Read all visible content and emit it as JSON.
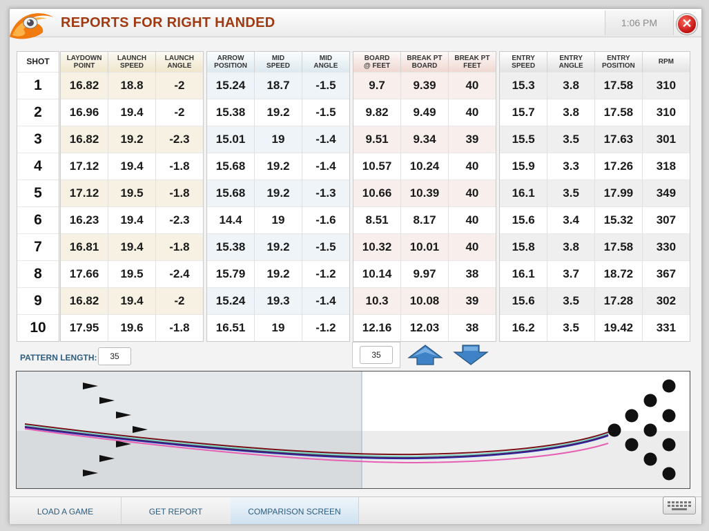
{
  "header": {
    "title": "REPORTS FOR RIGHT HANDED",
    "time": "1:06 PM",
    "close_label": "✕"
  },
  "groups": [
    {
      "columns": [
        "SHOT"
      ],
      "rows": [
        [
          "1"
        ],
        [
          "2"
        ],
        [
          "3"
        ],
        [
          "4"
        ],
        [
          "5"
        ],
        [
          "6"
        ],
        [
          "7"
        ],
        [
          "8"
        ],
        [
          "9"
        ],
        [
          "10"
        ]
      ]
    },
    {
      "columns": [
        [
          "LAYDOWN",
          "POINT"
        ],
        [
          "LAUNCH",
          "SPEED"
        ],
        [
          "LAUNCH",
          "ANGLE"
        ]
      ],
      "rows": [
        [
          "16.82",
          "18.8",
          "-2"
        ],
        [
          "16.96",
          "19.4",
          "-2"
        ],
        [
          "16.82",
          "19.2",
          "-2.3"
        ],
        [
          "17.12",
          "19.4",
          "-1.8"
        ],
        [
          "17.12",
          "19.5",
          "-1.8"
        ],
        [
          "16.23",
          "19.4",
          "-2.3"
        ],
        [
          "16.81",
          "19.4",
          "-1.8"
        ],
        [
          "17.66",
          "19.5",
          "-2.4"
        ],
        [
          "16.82",
          "19.4",
          "-2"
        ],
        [
          "17.95",
          "19.6",
          "-1.8"
        ]
      ]
    },
    {
      "columns": [
        [
          "ARROW",
          "POSITION"
        ],
        [
          "MID",
          "SPEED"
        ],
        [
          "MID",
          "ANGLE"
        ]
      ],
      "rows": [
        [
          "15.24",
          "18.7",
          "-1.5"
        ],
        [
          "15.38",
          "19.2",
          "-1.5"
        ],
        [
          "15.01",
          "19",
          "-1.4"
        ],
        [
          "15.68",
          "19.2",
          "-1.4"
        ],
        [
          "15.68",
          "19.2",
          "-1.3"
        ],
        [
          "14.4",
          "19",
          "-1.6"
        ],
        [
          "15.38",
          "19.2",
          "-1.5"
        ],
        [
          "15.79",
          "19.2",
          "-1.2"
        ],
        [
          "15.24",
          "19.3",
          "-1.4"
        ],
        [
          "16.51",
          "19",
          "-1.2"
        ]
      ]
    },
    {
      "columns": [
        [
          "BOARD",
          "@ FEET"
        ],
        [
          "BREAK PT",
          "BOARD"
        ],
        [
          "BREAK PT",
          "FEET"
        ]
      ],
      "rows": [
        [
          "9.7",
          "9.39",
          "40"
        ],
        [
          "9.82",
          "9.49",
          "40"
        ],
        [
          "9.51",
          "9.34",
          "39"
        ],
        [
          "10.57",
          "10.24",
          "40"
        ],
        [
          "10.66",
          "10.39",
          "40"
        ],
        [
          "8.51",
          "8.17",
          "40"
        ],
        [
          "10.32",
          "10.01",
          "40"
        ],
        [
          "10.14",
          "9.97",
          "38"
        ],
        [
          "10.3",
          "10.08",
          "39"
        ],
        [
          "12.16",
          "12.03",
          "38"
        ]
      ]
    },
    {
      "columns": [
        [
          "ENTRY",
          "SPEED"
        ],
        [
          "ENTRY",
          "ANGLE"
        ],
        [
          "ENTRY",
          "POSITION"
        ],
        [
          "RPM"
        ]
      ],
      "rows": [
        [
          "15.3",
          "3.8",
          "17.58",
          "310"
        ],
        [
          "15.7",
          "3.8",
          "17.58",
          "310"
        ],
        [
          "15.5",
          "3.5",
          "17.63",
          "301"
        ],
        [
          "15.9",
          "3.3",
          "17.26",
          "318"
        ],
        [
          "16.1",
          "3.5",
          "17.99",
          "349"
        ],
        [
          "15.6",
          "3.4",
          "15.32",
          "307"
        ],
        [
          "15.8",
          "3.8",
          "17.58",
          "330"
        ],
        [
          "16.1",
          "3.7",
          "18.72",
          "367"
        ],
        [
          "15.6",
          "3.5",
          "17.28",
          "302"
        ],
        [
          "16.2",
          "3.5",
          "19.42",
          "331"
        ]
      ]
    }
  ],
  "pattern": {
    "label": "PATTERN LENGTH:",
    "value": "35"
  },
  "breakpoint": {
    "value": "35"
  },
  "lane": {
    "pattern_feet": 35,
    "shot_colors": [
      "#7a0e16",
      "#2d7a3a",
      "#7fd6c8",
      "#1c2fb8",
      "#4a1a72",
      "#e65fb2"
    ]
  },
  "tabs": [
    "LOAD A GAME",
    "GET REPORT",
    "COMPARISON SCREEN"
  ],
  "active_tab": "COMPARISON SCREEN",
  "icons": [
    "eye-logo-icon",
    "close-icon",
    "arrow-up-icon",
    "arrow-down-icon",
    "keyboard-icon",
    "bowling-pin-icon",
    "lane-arrow-icon"
  ]
}
